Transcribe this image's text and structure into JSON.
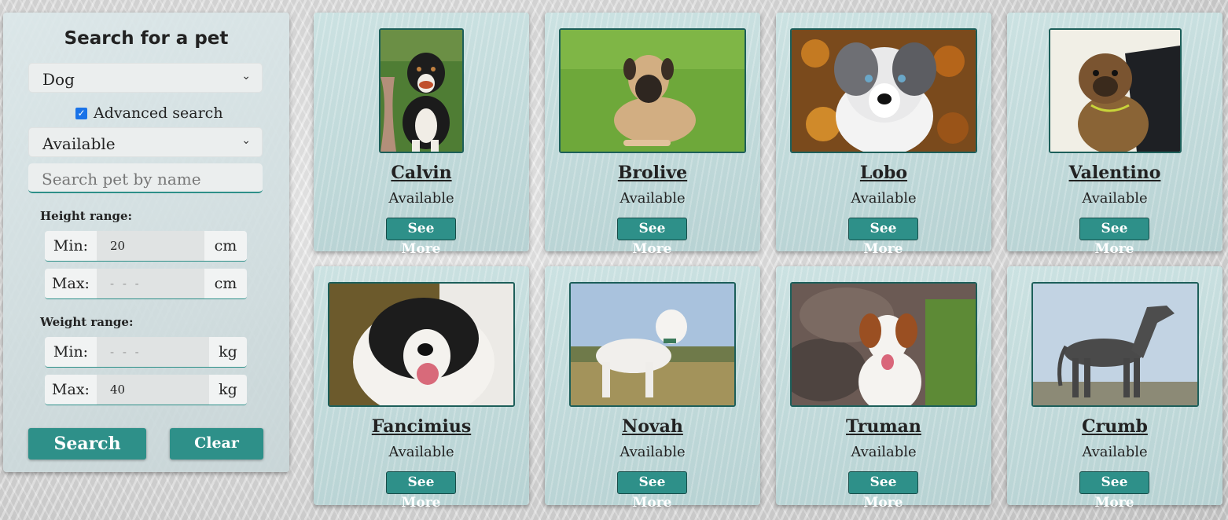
{
  "sidebar": {
    "title": "Search for a pet",
    "species_select": "Dog",
    "advanced_label": "Advanced search",
    "status_select": "Available",
    "name_placeholder": "Search pet by name",
    "height": {
      "label": "Height range:",
      "min_label": "Min:",
      "min_value": "20",
      "min_unit": "cm",
      "max_label": "Max:",
      "max_placeholder": "- - -",
      "max_unit": "cm"
    },
    "weight": {
      "label": "Weight range:",
      "min_label": "Min:",
      "min_placeholder": "- - -",
      "min_unit": "kg",
      "max_label": "Max:",
      "max_value": "40",
      "max_unit": "kg"
    },
    "search_button": "Search",
    "clear_button": "Clear",
    "chevron_icon": "chevron-down-icon"
  },
  "pets": [
    {
      "name": "Calvin",
      "status": "Available",
      "button": "See More"
    },
    {
      "name": "Brolive",
      "status": "Available",
      "button": "See More"
    },
    {
      "name": "Lobo",
      "status": "Available",
      "button": "See More"
    },
    {
      "name": "Valentino",
      "status": "Available",
      "button": "See More"
    },
    {
      "name": "Fancimius",
      "status": "Available",
      "button": "See More"
    },
    {
      "name": "Novah",
      "status": "Available",
      "button": "See More"
    },
    {
      "name": "Truman",
      "status": "Available",
      "button": "See More"
    },
    {
      "name": "Crumb",
      "status": "Available",
      "button": "See More"
    }
  ],
  "colors": {
    "accent": "#2e9089",
    "card_bg": "#c4dcdc",
    "photo_border": "#1d5f5a"
  }
}
